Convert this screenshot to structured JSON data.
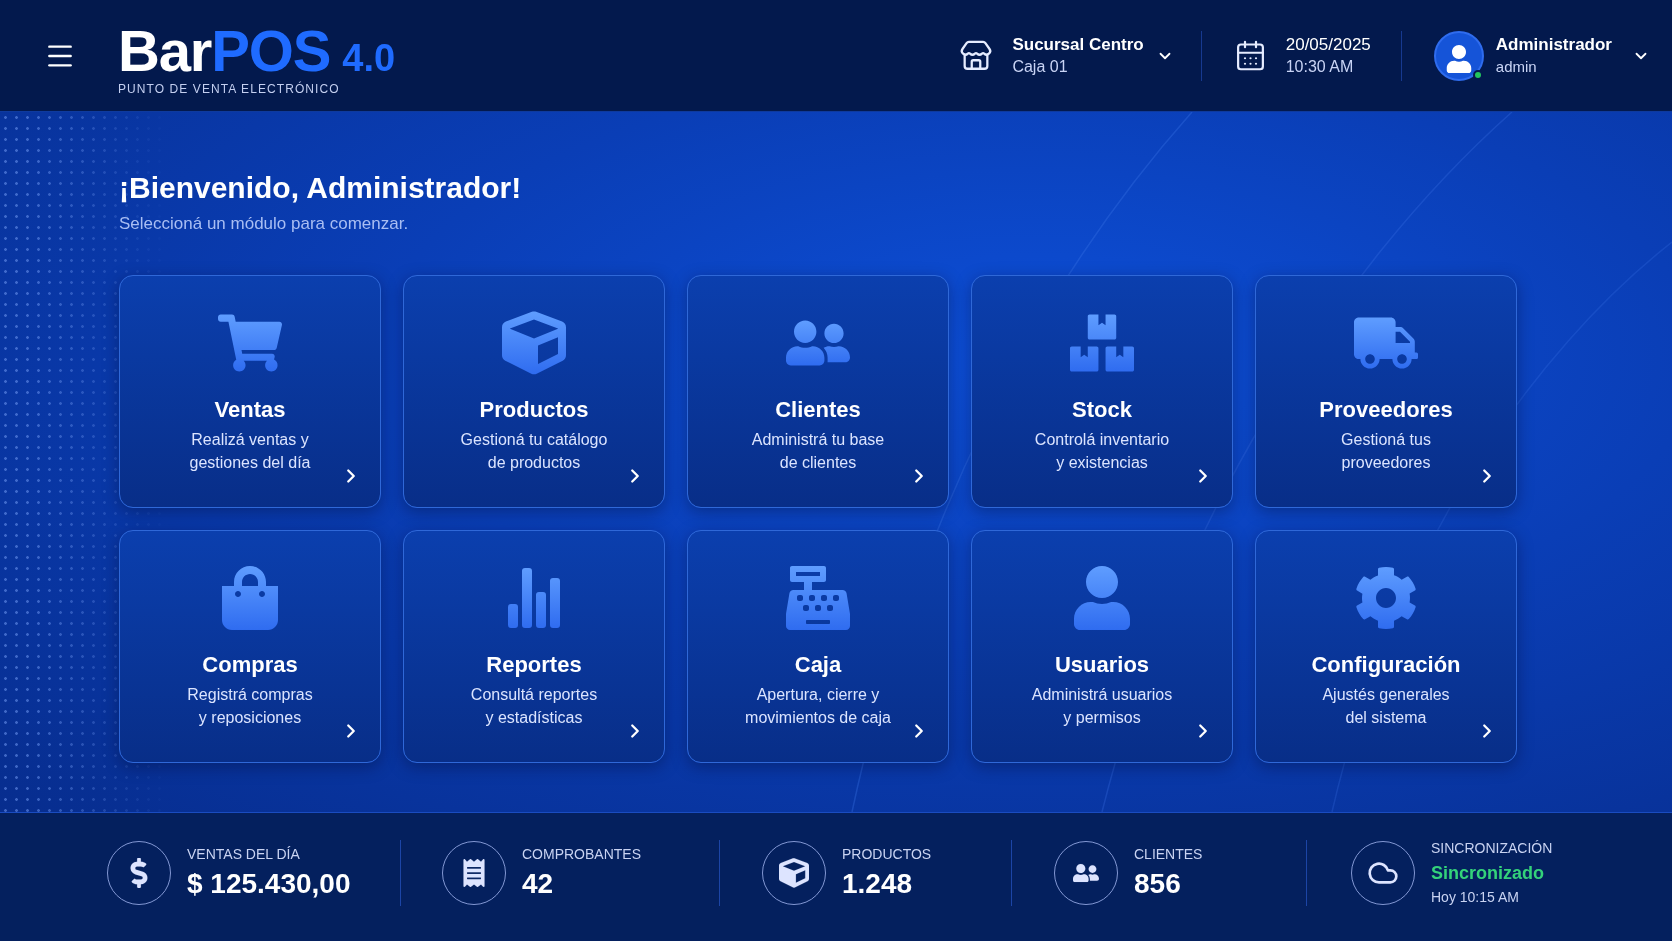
{
  "header": {
    "logo": {
      "primary": "Bar",
      "accent": "POS",
      "version": "4.0",
      "tagline": "PUNTO DE VENTA ELECTRÓNICO"
    },
    "branch": {
      "name": "Sucursal Centro",
      "register": "Caja 01"
    },
    "datetime": {
      "date": "20/05/2025",
      "time": "10:30 AM"
    },
    "user": {
      "name": "Administrador",
      "role": "admin",
      "online": true
    }
  },
  "welcome": {
    "title": "¡Bienvenido, Administrador!",
    "subtitle": "Seleccioná un módulo para comenzar."
  },
  "modules": [
    {
      "title": "Ventas",
      "description": [
        "Realizá ventas y",
        "gestiones del día"
      ]
    },
    {
      "title": "Productos",
      "description": [
        "Gestioná tu catálogo",
        "de productos"
      ]
    },
    {
      "title": "Clientes",
      "description": [
        "Administrá tu base",
        "de clientes"
      ]
    },
    {
      "title": "Stock",
      "description": [
        "Controlá inventario",
        "y existencias"
      ]
    },
    {
      "title": "Proveedores",
      "description": [
        "Gestioná tus",
        "proveedores"
      ]
    },
    {
      "title": "Compras",
      "description": [
        "Registrá compras",
        "y reposiciones"
      ]
    },
    {
      "title": "Reportes",
      "description": [
        "Consultá reportes",
        "y estadísticas"
      ]
    },
    {
      "title": "Caja",
      "description": [
        "Apertura, cierre y",
        "movimientos de caja"
      ]
    },
    {
      "title": "Usuarios",
      "description": [
        "Administrá usuarios",
        "y permisos"
      ]
    },
    {
      "title": "Configuración",
      "description": [
        "Ajustés generales",
        "del sistema"
      ]
    }
  ],
  "stats": [
    {
      "kind": "metric",
      "label": "VENTAS DEL DÍA",
      "value": "$ 125.430,00"
    },
    {
      "kind": "metric",
      "label": "COMPROBANTES",
      "value": "42"
    },
    {
      "kind": "metric",
      "label": "PRODUCTOS",
      "value": "1.248"
    },
    {
      "kind": "metric",
      "label": "CLIENTES",
      "value": "856"
    },
    {
      "kind": "status",
      "label": "SINCRONIZACIÓN",
      "value": "Sincronizado",
      "detail": "Hoy 10:15 AM"
    }
  ]
}
